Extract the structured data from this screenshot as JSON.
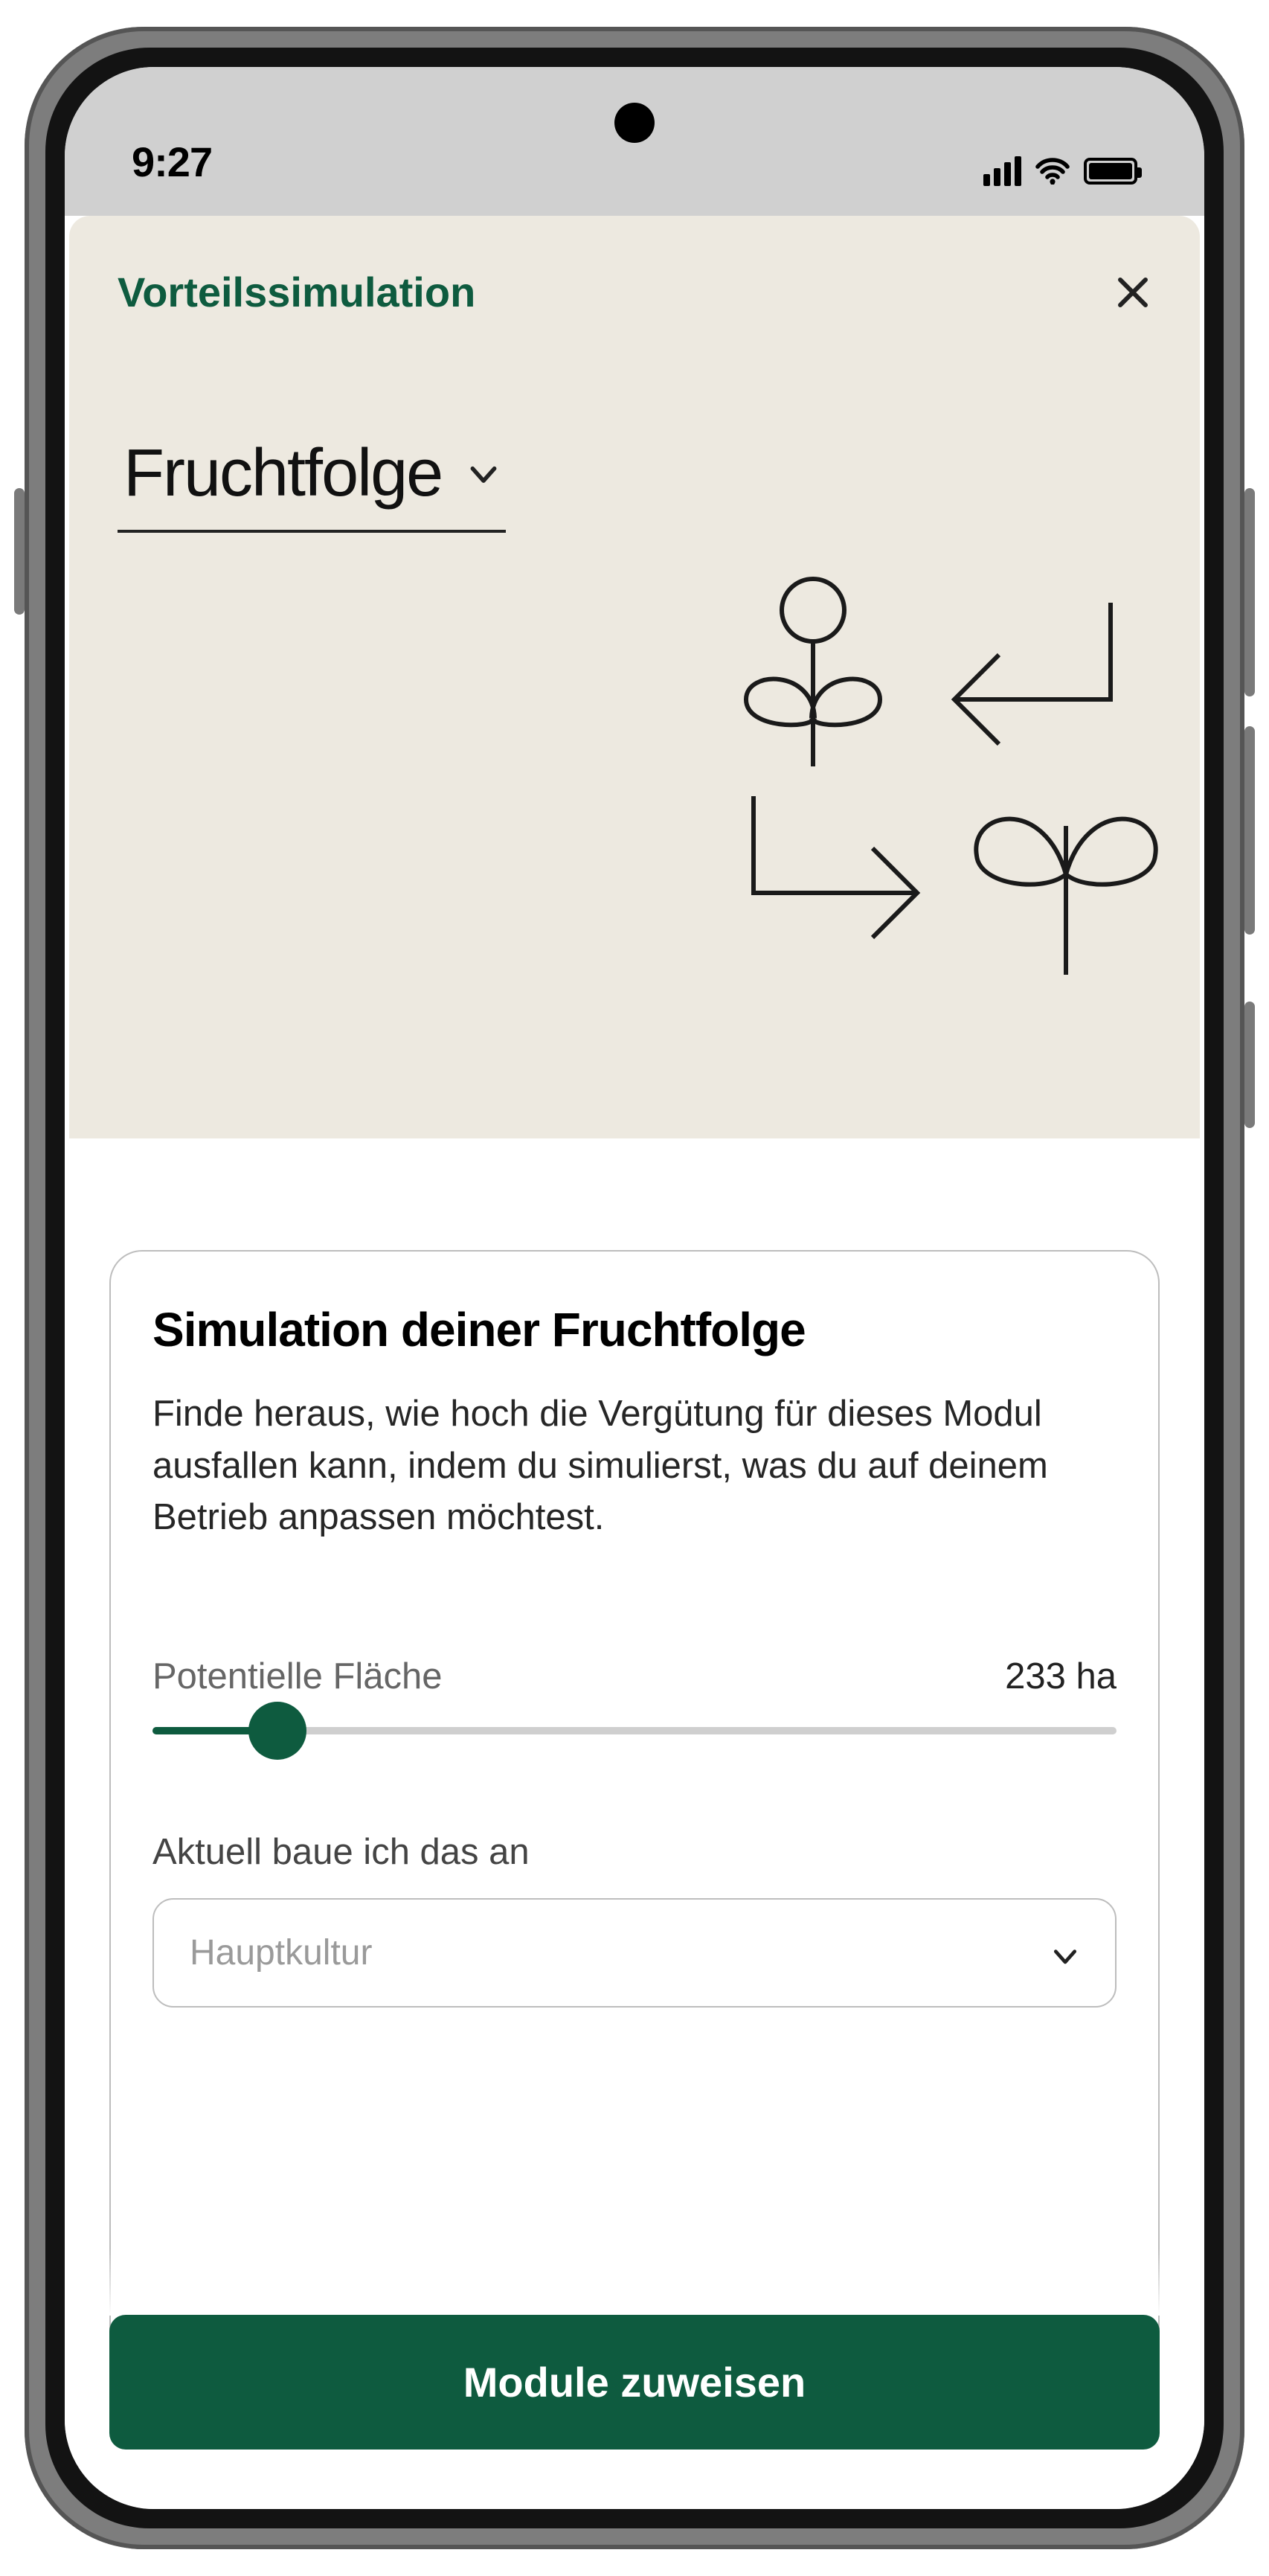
{
  "status": {
    "time": "9:27"
  },
  "hero": {
    "title": "Vorteilssimulation",
    "dropdown_label": "Fruchtfolge"
  },
  "card": {
    "title": "Simulation deiner Fruchtfolge",
    "description": "Finde heraus, wie hoch die Vergütung für dieses Modul ausfallen kann, indem du simulierst, was du auf deinem Betrieb anpassen möchtest.",
    "slider_label": "Potentielle Fläche",
    "slider_value_display": "233 ha",
    "slider_percent": 13,
    "field_label": "Aktuell baue ich das an",
    "select_placeholder": "Hauptkultur"
  },
  "cta": {
    "label": "Module zuweisen"
  },
  "colors": {
    "accent": "#0e5b3f",
    "hero_bg": "#ede9e0"
  }
}
